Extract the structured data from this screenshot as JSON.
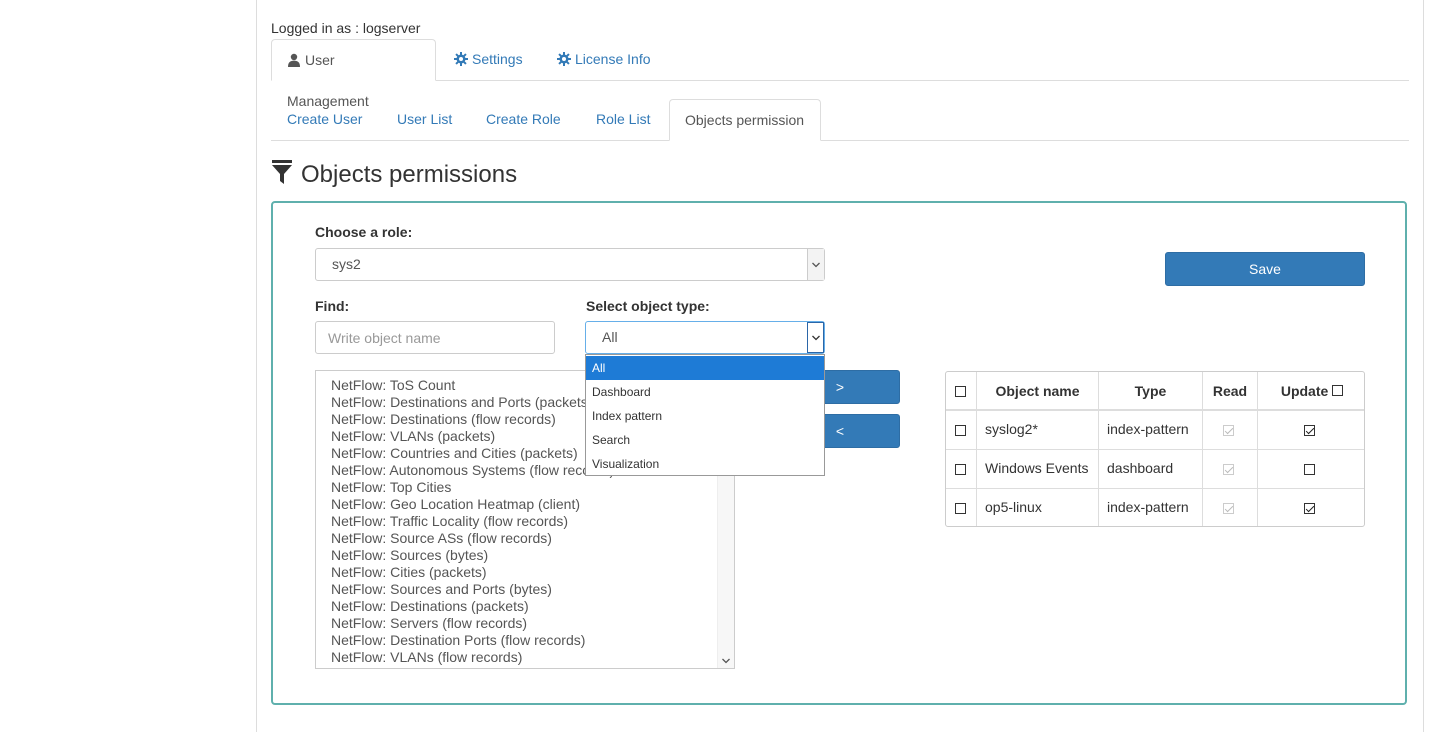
{
  "header": {
    "logged_in_text": "Logged in as : logserver"
  },
  "main_tabs": [
    {
      "label": "User Management",
      "icon": "user-icon",
      "active": true
    },
    {
      "label": "Settings",
      "icon": "gear-icon",
      "active": false
    },
    {
      "label": "License Info",
      "icon": "gear-icon",
      "active": false
    }
  ],
  "sub_tabs": [
    {
      "label": "Create User",
      "active": false
    },
    {
      "label": "User List",
      "active": false
    },
    {
      "label": "Create Role",
      "active": false
    },
    {
      "label": "Role List",
      "active": false
    },
    {
      "label": "Objects permission",
      "active": true
    }
  ],
  "page_title": "Objects permissions",
  "form": {
    "role_label": "Choose a role:",
    "role_value": "sys2",
    "find_label": "Find:",
    "find_placeholder": "Write object name",
    "type_label": "Select object type:",
    "type_value": "All",
    "type_options": [
      "All",
      "Dashboard",
      "Index pattern",
      "Search",
      "Visualization"
    ],
    "save_label": "Save",
    "move_right_label": ">",
    "move_left_label": "<"
  },
  "object_list": [
    "NetFlow: ToS Count",
    "NetFlow: Destinations and Ports (packets)",
    "NetFlow: Destinations (flow records)",
    "NetFlow: VLANs (packets)",
    "NetFlow: Countries and Cities (packets)",
    "NetFlow: Autonomous Systems (flow records)",
    "NetFlow: Top Cities",
    "NetFlow: Geo Location Heatmap (client)",
    "NetFlow: Traffic Locality (flow records)",
    "NetFlow: Source ASs (flow records)",
    "NetFlow: Sources (bytes)",
    "NetFlow: Cities (packets)",
    "NetFlow: Sources and Ports (bytes)",
    "NetFlow: Destinations (packets)",
    "NetFlow: Servers (flow records)",
    "NetFlow: Destination Ports (flow records)",
    "NetFlow: VLANs (flow records)"
  ],
  "table": {
    "headers": {
      "name": "Object name",
      "type": "Type",
      "read": "Read",
      "update": "Update"
    },
    "rows": [
      {
        "name": "syslog2*",
        "type": "index-pattern",
        "read": true,
        "update": true
      },
      {
        "name": "Windows Events",
        "type": "dashboard",
        "read": true,
        "update": false
      },
      {
        "name": "op5-linux",
        "type": "index-pattern",
        "read": true,
        "update": true
      }
    ]
  },
  "colors": {
    "link": "#337ab7",
    "primary_button": "#337ab7",
    "panel_border": "#5fb0ad",
    "dropdown_selected": "#1e7bd6"
  }
}
